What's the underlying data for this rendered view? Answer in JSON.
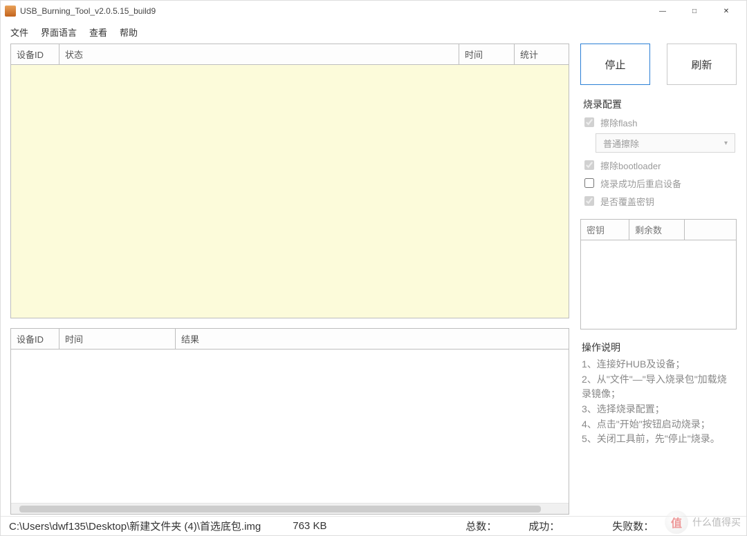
{
  "title": "USB_Burning_Tool_v2.0.5.15_build9",
  "menu": {
    "file": "文件",
    "lang": "界面语言",
    "view": "查看",
    "help": "帮助"
  },
  "upper_table": {
    "headers": {
      "device_id": "设备ID",
      "status": "状态",
      "time": "时间",
      "stats": "统计"
    }
  },
  "lower_table": {
    "headers": {
      "device_id": "设备ID",
      "time": "时间",
      "result": "结果"
    }
  },
  "buttons": {
    "stop": "停止",
    "refresh": "刷新"
  },
  "config": {
    "title": "烧录配置",
    "erase_flash": "擦除flash",
    "erase_mode": "普通擦除",
    "erase_bootloader": "擦除bootloader",
    "reboot_after": "烧录成功后重启设备",
    "overwrite_key": "是否覆盖密钥"
  },
  "key_table": {
    "headers": {
      "key": "密钥",
      "remaining": "剩余数"
    }
  },
  "instructions": {
    "title": "操作说明",
    "lines": [
      "1、连接好HUB及设备；",
      "2、从\"文件\"—\"导入烧录包\"加载烧录镜像；",
      "3、选择烧录配置；",
      "4、点击\"开始\"按钮启动烧录；",
      "5、关闭工具前，先\"停止\"烧录。"
    ]
  },
  "status": {
    "path": "C:\\Users\\dwf135\\Desktop\\新建文件夹 (4)\\首选底包.img",
    "size": "763 KB",
    "total_label": "总数：",
    "success_label": "成功：",
    "fail_label": "失败数："
  },
  "watermark": {
    "badge": "值",
    "text": "什么值得买"
  }
}
